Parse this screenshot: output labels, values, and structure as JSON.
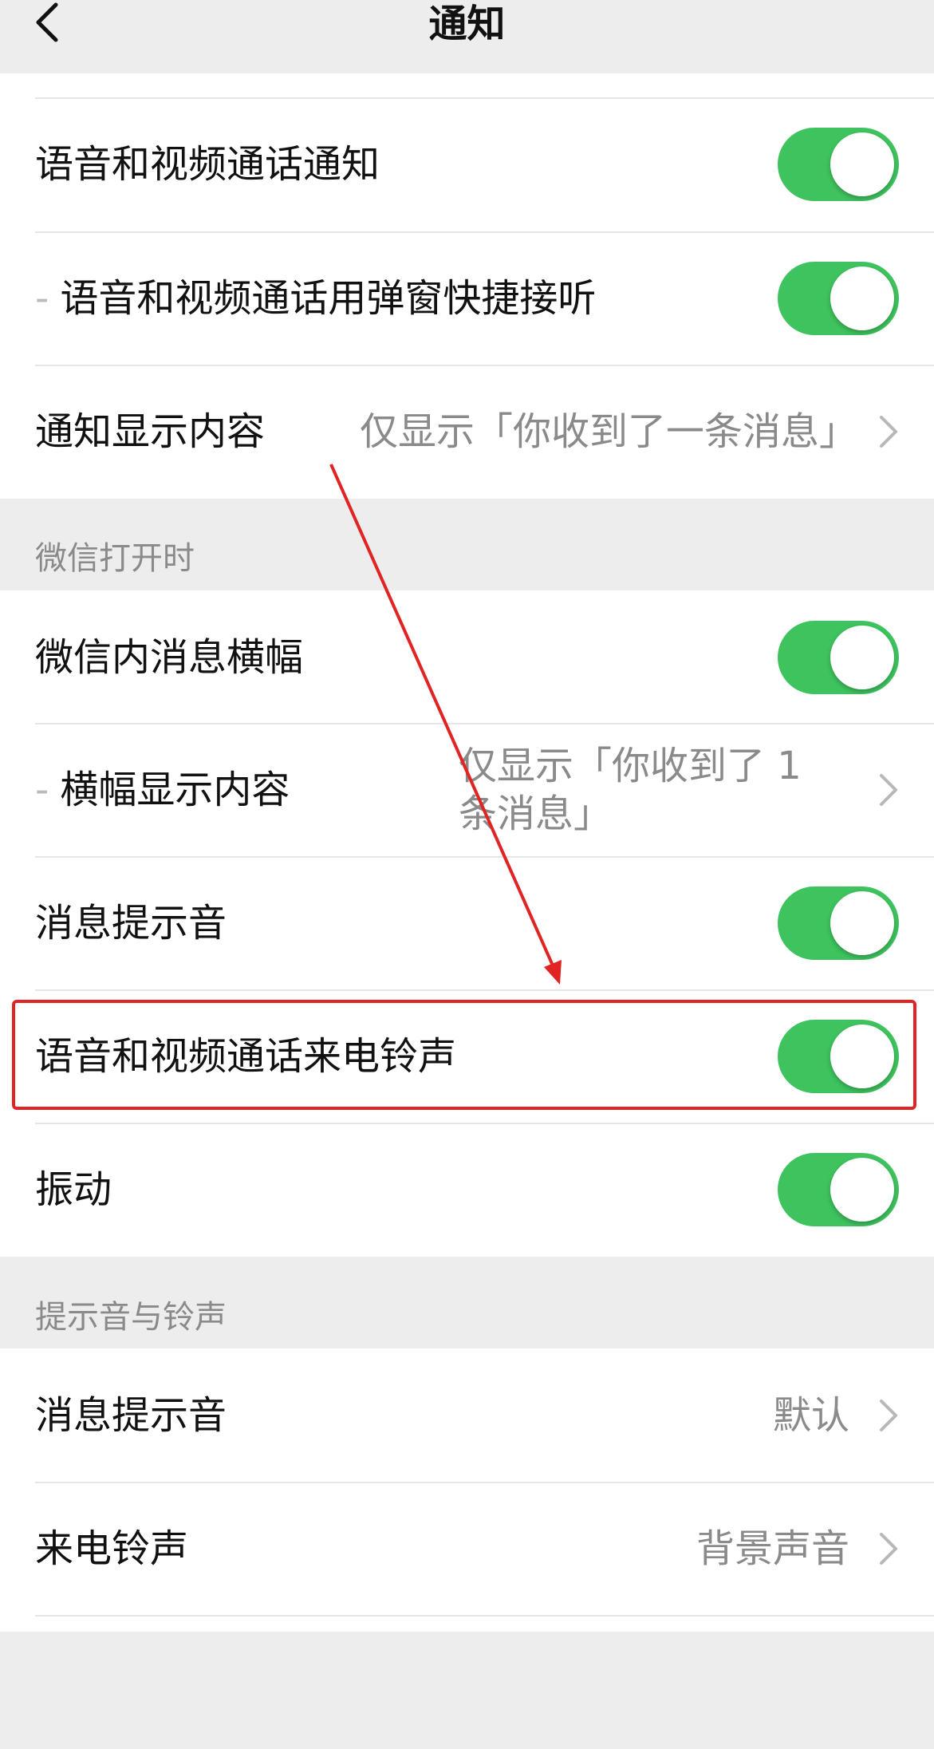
{
  "nav": {
    "title": "通知",
    "back_icon": "chevron-left-icon"
  },
  "colors": {
    "toggle_on": "#3ec35e",
    "highlight": "#e02424",
    "background": "#ededed",
    "secondary_text": "#8a8a8a"
  },
  "section1": {
    "rows": [
      {
        "label": "语音和视频通话通知",
        "toggle": true
      },
      {
        "prefix": "-",
        "label": "语音和视频通话用弹窗快捷接听",
        "toggle": true
      },
      {
        "label": "通知显示内容",
        "value": "仅显示「你收到了一条消息」"
      }
    ]
  },
  "section2": {
    "header": "微信打开时",
    "rows": [
      {
        "label": "微信内消息横幅",
        "toggle": true
      },
      {
        "prefix": "-",
        "label": "横幅显示内容",
        "value": "仅显示「你收到了 1 条消息」"
      },
      {
        "label": "消息提示音",
        "toggle": true
      },
      {
        "label": "语音和视频通话来电铃声",
        "toggle": true
      },
      {
        "label": "振动",
        "toggle": true
      }
    ]
  },
  "section3": {
    "header": "提示音与铃声",
    "rows": [
      {
        "label": "消息提示音",
        "value": "默认"
      },
      {
        "label": "来电铃声",
        "value": "背景声音"
      }
    ]
  }
}
